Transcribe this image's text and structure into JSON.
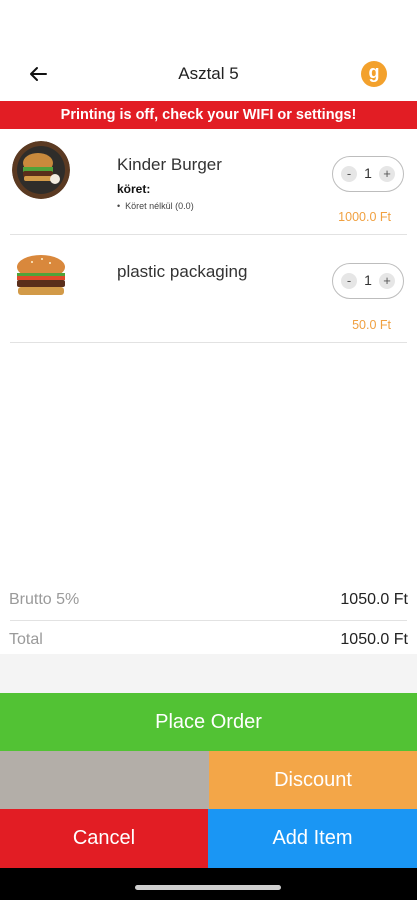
{
  "header": {
    "title": "Asztal 5",
    "logo_letter": "g"
  },
  "banner": {
    "text": "Printing is off, check your WIFI or settings!"
  },
  "items": [
    {
      "name": "Kinder Burger",
      "sub_label": "köret:",
      "option": "Köret nélkül (0.0)",
      "quantity": "1",
      "price": "1000.0 Ft",
      "image": "burger-icon"
    },
    {
      "name": "plastic packaging",
      "quantity": "1",
      "price": "50.0 Ft",
      "image": "burger-icon"
    }
  ],
  "totals": {
    "brutto_label": "Brutto 5%",
    "brutto_value": "1050.0 Ft",
    "total_label": "Total",
    "total_value": "1050.0 Ft"
  },
  "buttons": {
    "place_order": "Place Order",
    "discount": "Discount",
    "cancel": "Cancel",
    "add_item": "Add Item"
  },
  "colors": {
    "green": "#52c234",
    "orange": "#f3a648",
    "gray": "#b3aea8",
    "red": "#e21d24",
    "blue": "#1a96f4",
    "price": "#f0a040"
  }
}
